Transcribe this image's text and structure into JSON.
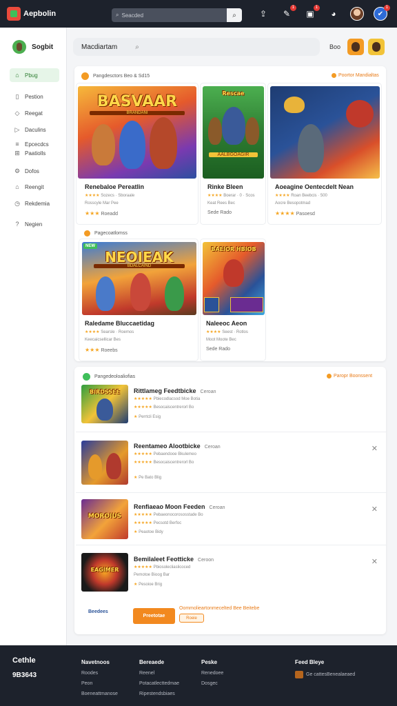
{
  "app": {
    "name": "Aepbolin"
  },
  "topbar": {
    "search_placeholder": "Seacded",
    "badges": [
      "1",
      "1",
      "1"
    ]
  },
  "sidebar": {
    "user_name": "Sogbit",
    "items": [
      {
        "label": "Pbug",
        "icon": "home-icon"
      },
      {
        "label": "Pestion",
        "icon": "doc-icon"
      },
      {
        "label": "Reegat",
        "icon": "tag-icon"
      },
      {
        "label": "Daculins",
        "icon": "play-icon"
      },
      {
        "label": "Epcecdcs",
        "icon": "list-icon"
      },
      {
        "label": "Paatiolls",
        "icon": "grid-icon"
      },
      {
        "label": "Dofos",
        "icon": "gear-icon"
      },
      {
        "label": "Reengit",
        "icon": "home-icon"
      },
      {
        "label": "Rekdemia",
        "icon": "clock-icon"
      },
      {
        "label": "Negien",
        "icon": "help-icon"
      }
    ]
  },
  "main": {
    "search_value": "Macdiartam",
    "tools_label": "Boo"
  },
  "featured": {
    "heading": "Pangdesctors Beo & Sd15",
    "link": "Poortor Mandialtas",
    "cards": [
      {
        "title": "Renebaloe Pereatlin",
        "meta1": "Sozecs · Sboraale",
        "meta2": "Rosscyle Mar Pee",
        "stars": "★★★",
        "price": "Roeadd",
        "art": "BASVAAR",
        "art_sub": "BRANDANI"
      },
      {
        "title": "Rinke Bleen",
        "meta1": "Boerar · 0 · Scos",
        "meta2": "Keat Rees Bec",
        "stars": "",
        "price": "Sede Rado",
        "art": "Rescae",
        "art_sub": "AALBGOAGIR"
      },
      {
        "title": "Aoeagine Oentecdelt Nean",
        "meta1": "Roan Beebcis · 500",
        "meta2": "Aocre Besopotmad",
        "stars": "★★★★",
        "price": "Pasoesd",
        "art": "",
        "art_sub": ""
      }
    ]
  },
  "second": {
    "heading": "Pagecoatlomss",
    "new_tag": "NEW",
    "cards": [
      {
        "title": "Raledame Bluccaetidag",
        "meta1": "Searsle · Roemos",
        "meta2": "Keecaicsellicar Bes",
        "stars": "★★★",
        "price": "Roeebs",
        "art": "NEOIEAK",
        "art_sub": "BDALCAIND"
      },
      {
        "title": "Naleeoc Aeon",
        "meta1": "Seest · Rotlos",
        "meta2": "Moot Moote Bec",
        "stars": "",
        "price": "Sede Rado",
        "art": "BAEIOR HBIOB",
        "art_sub": ""
      }
    ]
  },
  "list": {
    "heading": "Pangedeoloaliofias",
    "link": "Paropr Boonssent",
    "items": [
      {
        "title": "Rittlameg Feedtbicke",
        "sub": "Ceroan",
        "line1": "Pbiecodlacsod Moe Botia",
        "line2": "Besocaiscentrerorl Bo",
        "line3": "Perrtcli Esig",
        "art": "BIRDSSEE"
      },
      {
        "title": "Reentameo Alootbicke",
        "sub": "Ceroan",
        "line1": "Pebaendooe Bkulemeo",
        "line2": "Besocaiscentrerorl Bo",
        "line3": "Pe Bato Blig",
        "art": ""
      },
      {
        "title": "Renfiaeao Moon Feeden",
        "sub": "Ceroan",
        "line1": "Pebaeonocorososstade Bo",
        "line2": "Pecsotd Berfoc",
        "line3": "Peaotoe Bidy",
        "art": "MOROIUS"
      },
      {
        "title": "Bemilaleet Feotticke",
        "sub": "Ceroon",
        "line1": "Pbiosolecliaslicoced",
        "line2": "Pemotoe Bioog Bar",
        "line3": "Pesoioe Brig",
        "art": "EAGIMER"
      }
    ]
  },
  "cta": {
    "logo": "Beedees",
    "button": "Preetotae",
    "text": "Oommolieartonmecelted Bee Beitebe",
    "pill": "Roeie"
  },
  "footer": {
    "brand": "Cethle",
    "number": "9B3643",
    "cols": [
      {
        "head": "Navetnoos",
        "items": [
          "Roodes",
          "Peon",
          "Boeneattmanose"
        ]
      },
      {
        "head": "Bereaede",
        "items": [
          "Reenel",
          "Potacatlecttedmae",
          "Ripestendsbiaes"
        ]
      },
      {
        "head": "Peske",
        "items": [
          "Renedoee",
          "Dosgec"
        ]
      }
    ],
    "app_head": "Feed Bleye",
    "app_line": "Ge cattesBenealaeaed"
  }
}
